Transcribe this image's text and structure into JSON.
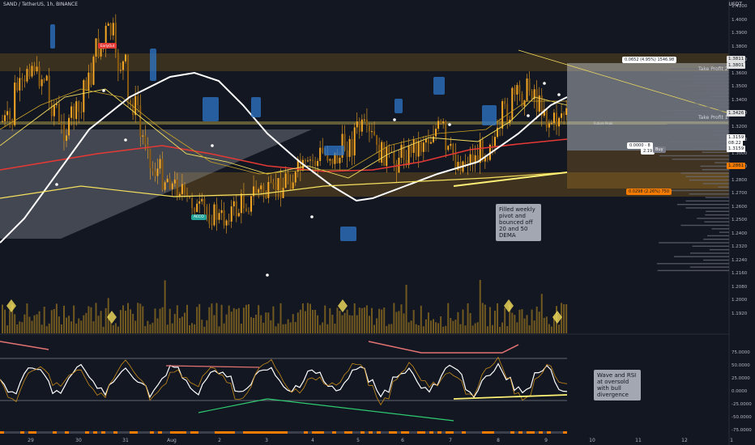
{
  "header": {
    "title": "SAND / TetherUS, 1h, BINANCE",
    "unit": "USDT"
  },
  "price_axis": [
    "1.4100",
    "1.4000",
    "1.3900",
    "1.3800",
    "1.3700",
    "1.3600",
    "1.3500",
    "1.3400",
    "1.3300",
    "1.3200",
    "1.3100",
    "1.3000",
    "1.2900",
    "1.2800",
    "1.2700",
    "1.2600",
    "1.2500",
    "1.2400",
    "1.2320",
    "1.2240",
    "1.2160",
    "1.2080",
    "1.2000",
    "1.1920"
  ],
  "price_tags": {
    "t1": "1.3811",
    "t2": "1.3801",
    "t3": "1.3426",
    "t4": "1.3159",
    "t5": "08:22",
    "t6": "1.3159",
    "t7": "1.2861"
  },
  "rsi_axis": [
    "75.0000",
    "50.0000",
    "25.0000",
    "0.0000",
    "-25.0000",
    "-50.0000",
    "-75.0000"
  ],
  "date_axis": [
    "29",
    "30",
    "31",
    "Aug",
    "2",
    "3",
    "4",
    "5",
    "6",
    "7",
    "8",
    "9",
    "10",
    "11",
    "12",
    "1"
  ],
  "position": {
    "target_label": "0.0652 (4.95%) 1546.98",
    "take_profit_2": "Take Profit 2",
    "take_profit_1": "Take Profit 1",
    "future_peak": "Future Peak",
    "entry_label": "0.0000 - 8",
    "entry_sub": "2.19",
    "entry_badge": "Buy",
    "stop_label": "0.0298 (2.26%) 750"
  },
  "markers": {
    "sell_label": "EarlyOut",
    "aeco_label": "AECO"
  },
  "callouts": {
    "pivot": "Filled weekly pivot and bounced off 20 and 50 DEMA",
    "wave": "Wave and RSI at oversold with bull divergence"
  },
  "colors": {
    "bg": "#131722",
    "candle": "#f5a623",
    "ema_red": "#e53935",
    "ema_yellow": "#f6e05e",
    "white": "#ffffff",
    "cloud": "#2e77c9",
    "green": "#2ecc71"
  }
}
